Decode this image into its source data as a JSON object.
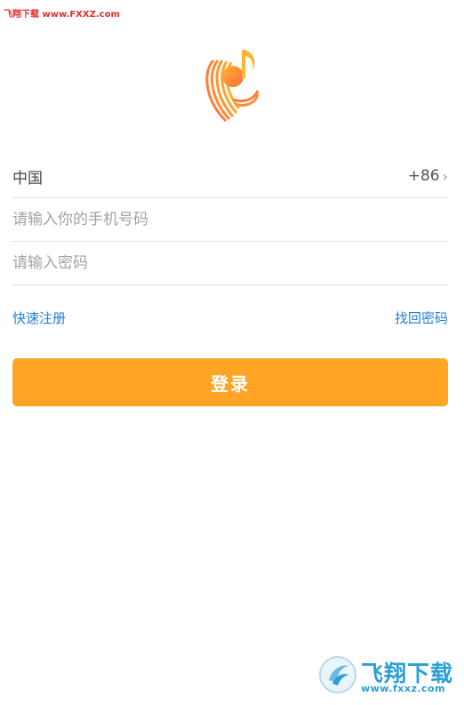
{
  "watermark": {
    "top_text": "飞翔下载 www.FXXZ.com"
  },
  "logo": {
    "icon": "music-note-logo-icon"
  },
  "form": {
    "country_label": "中国",
    "country_code": "+86",
    "phone_placeholder": "请输入你的手机号码",
    "password_placeholder": "请输入密码"
  },
  "links": {
    "register": "快速注册",
    "forgot": "找回密码"
  },
  "login_button": "登录",
  "badge": {
    "title": "飞翔下载",
    "url": "www.fxxz.com"
  },
  "colors": {
    "accent": "#ffa424",
    "link": "#1f7fd8",
    "watermark": "#e0302a"
  }
}
